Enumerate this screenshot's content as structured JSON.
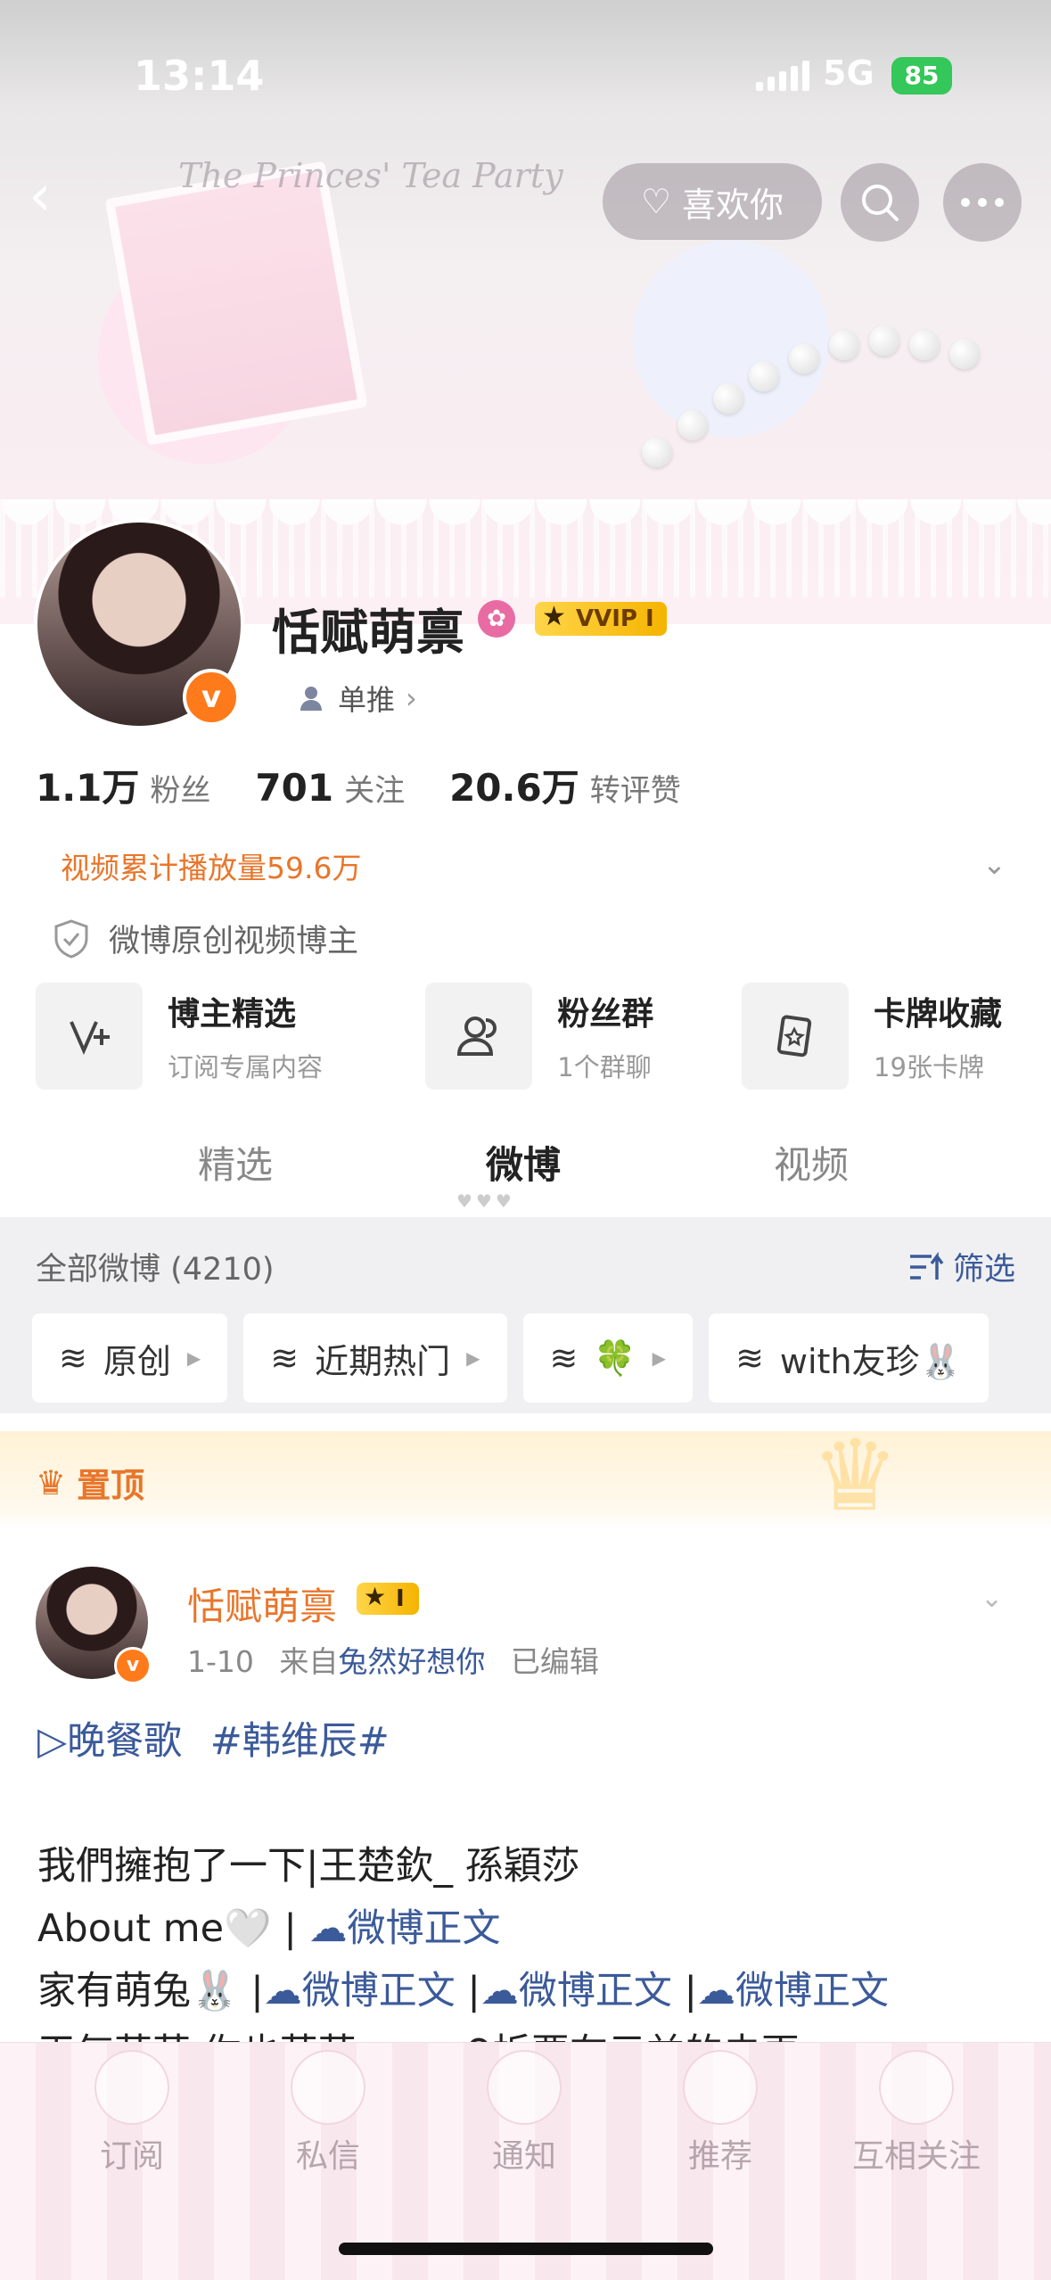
{
  "status_bar": {
    "time": "13:14",
    "network": "5G",
    "battery": "85"
  },
  "nav": {
    "like_label": "喜欢你"
  },
  "profile": {
    "name": "恬赋萌禀",
    "vip_label": "VVIP I",
    "tag": "单推",
    "badge": "v",
    "stats": [
      {
        "value": "1.1万",
        "label": "粉丝"
      },
      {
        "value": "701",
        "label": "关注"
      },
      {
        "value": "20.6万",
        "label": "转评赞"
      }
    ],
    "video_count": "视频累计播放量59.6万",
    "creator_label": "微博原创视频博主"
  },
  "cards": [
    {
      "title": "博主精选",
      "sub": "订阅专属内容",
      "icon": "v-plus-icon"
    },
    {
      "title": "粉丝群",
      "sub": "1个群聊",
      "icon": "group-icon"
    },
    {
      "title": "卡牌收藏",
      "sub": "19张卡牌",
      "icon": "card-icon"
    }
  ],
  "tabs": [
    "精选",
    "微博",
    "视频"
  ],
  "filter": {
    "all_label": "全部微博 (4210)",
    "filter_label": "筛选",
    "chips": [
      "原创",
      "近期热门",
      "🍀",
      "with友珍🐰"
    ]
  },
  "pinned": {
    "label": "置顶"
  },
  "post": {
    "author": "恬赋萌禀",
    "vip_label": "I",
    "badge": "v",
    "date": "1-10",
    "from_prefix": "来自",
    "source": "兔然好想你",
    "edited": "已编辑",
    "line1_play": "▷晚餐歌",
    "line1_topic": "#韩维辰#",
    "line2": "我們擁抱了一下|王楚欽_ 孫穎莎",
    "line3_text": "About me🤍 | ",
    "link_label": "微博正文",
    "line4_text": "家有萌兔🐰 |",
    "line5_partial": "天气萌萌 你也萌萌>ω< ♀拆要在元益的未更"
  },
  "tabbar": [
    "订阅",
    "私信",
    "通知",
    "推荐",
    "互相关注"
  ],
  "colors": {
    "accent_orange": "#e8762b",
    "link_blue": "#3b5a9a",
    "vip_gold": "#f5b400"
  }
}
